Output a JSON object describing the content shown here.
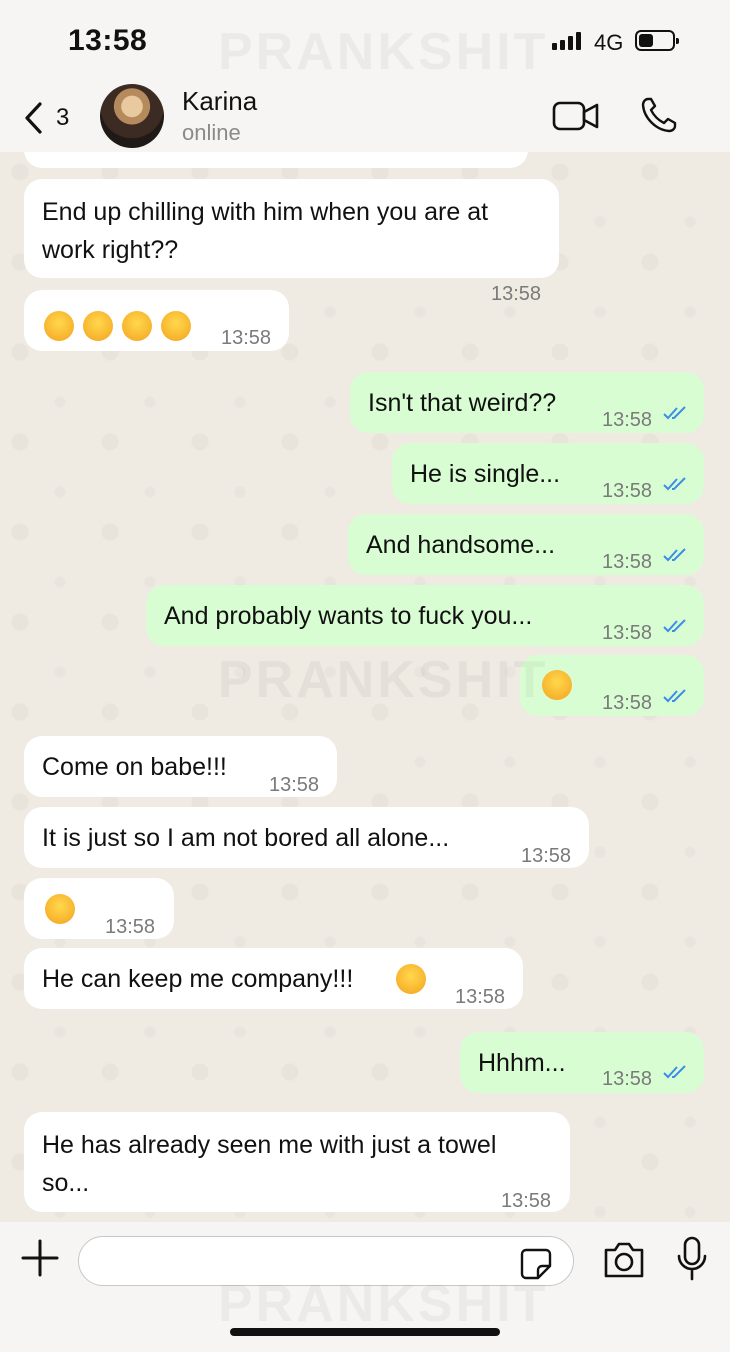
{
  "status_bar": {
    "time": "13:58",
    "network": "4G"
  },
  "watermark": "PRANKSHIT",
  "header": {
    "back_count": "3",
    "contact_name": "Karina",
    "contact_status": "online"
  },
  "messages": [
    {
      "dir": "in",
      "text": "End up chilling with him when you are at work right??",
      "lines": [
        "End up chilling with him when you are at",
        "work right??"
      ],
      "time": "13:58"
    },
    {
      "dir": "in",
      "emoji": [
        "flushed-face",
        "flushed-face",
        "hand-over-mouth-face",
        "hand-over-mouth-face"
      ],
      "time": "13:58"
    },
    {
      "dir": "out",
      "text": "Isn't that weird??",
      "time": "13:58",
      "read": true
    },
    {
      "dir": "out",
      "text": "He is single...",
      "time": "13:58",
      "read": true
    },
    {
      "dir": "out",
      "text": "And handsome...",
      "time": "13:58",
      "read": true
    },
    {
      "dir": "out",
      "text": "And probably wants to fuck you...",
      "time": "13:58",
      "read": true
    },
    {
      "dir": "out",
      "emoji": [
        "grimacing-face"
      ],
      "time": "13:58",
      "read": true
    },
    {
      "dir": "in",
      "text": "Come on babe!!!",
      "time": "13:58"
    },
    {
      "dir": "in",
      "text": "It is just so I am not bored all alone...",
      "time": "13:58"
    },
    {
      "dir": "in",
      "emoji": [
        "weary-face"
      ],
      "time": "13:58"
    },
    {
      "dir": "in",
      "text": "He can keep me company!!!",
      "trailing_emoji": "star-struck-face",
      "time": "13:58"
    },
    {
      "dir": "out",
      "text": "Hhhm...",
      "time": "13:58",
      "read": true
    },
    {
      "dir": "in",
      "text": "He has already seen me with just a towel so...",
      "lines": [
        "He has already seen me with just a towel",
        "so..."
      ],
      "time": "13:58"
    }
  ],
  "colors": {
    "incoming_bubble": "#ffffff",
    "outgoing_bubble": "#d9fdd3",
    "read_ticks": "#3a8ee6",
    "chat_background": "#efeae2"
  },
  "input": {
    "placeholder": ""
  }
}
